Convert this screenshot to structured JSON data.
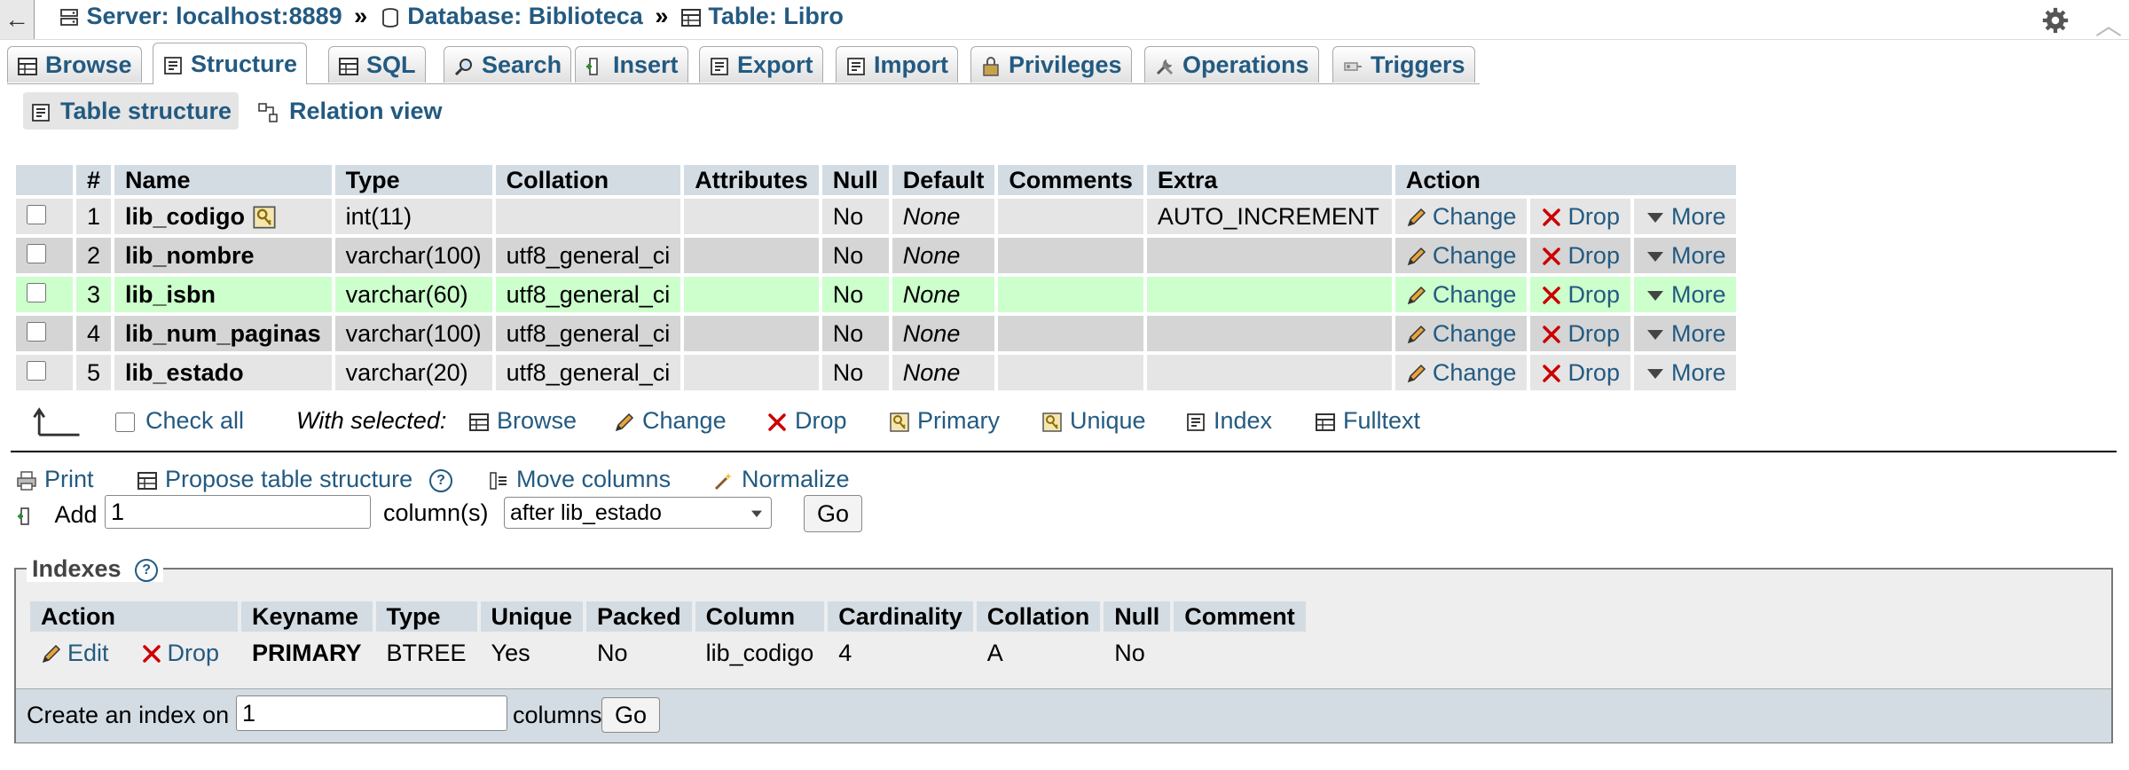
{
  "nav": {
    "back_glyph": "←",
    "breadcrumb": [
      {
        "label": "Server: localhost:8889",
        "icon": "server-icon"
      },
      {
        "label": "Database: Biblioteca",
        "icon": "database-icon"
      },
      {
        "label": "Table: Libro",
        "icon": "table-icon"
      }
    ],
    "separator": "»"
  },
  "tabs": [
    {
      "label": "Browse",
      "icon": "browse-icon"
    },
    {
      "label": "Structure",
      "icon": "structure-icon",
      "active": true
    },
    {
      "label": "SQL",
      "icon": "sql-icon"
    },
    {
      "label": "Search",
      "icon": "search-icon"
    },
    {
      "label": "Insert",
      "icon": "insert-icon"
    },
    {
      "label": "Export",
      "icon": "export-icon"
    },
    {
      "label": "Import",
      "icon": "import-icon"
    },
    {
      "label": "Privileges",
      "icon": "privileges-icon"
    },
    {
      "label": "Operations",
      "icon": "operations-icon"
    },
    {
      "label": "Triggers",
      "icon": "triggers-icon"
    }
  ],
  "subtabs": {
    "structure": "Table structure",
    "relation": "Relation view"
  },
  "structure_table": {
    "headers": [
      "#",
      "Name",
      "Type",
      "Collation",
      "Attributes",
      "Null",
      "Default",
      "Comments",
      "Extra",
      "Action"
    ],
    "rows": [
      {
        "num": "1",
        "name": "lib_codigo",
        "type": "int(11)",
        "collation": "",
        "attributes": "",
        "null": "No",
        "default": "None",
        "comments": "",
        "extra": "AUTO_INCREMENT",
        "primary_key": true
      },
      {
        "num": "2",
        "name": "lib_nombre",
        "type": "varchar(100)",
        "collation": "utf8_general_ci",
        "attributes": "",
        "null": "No",
        "default": "None",
        "comments": "",
        "extra": ""
      },
      {
        "num": "3",
        "name": "lib_isbn",
        "type": "varchar(60)",
        "collation": "utf8_general_ci",
        "attributes": "",
        "null": "No",
        "default": "None",
        "comments": "",
        "extra": "",
        "highlighted": true
      },
      {
        "num": "4",
        "name": "lib_num_paginas",
        "type": "varchar(100)",
        "collation": "utf8_general_ci",
        "attributes": "",
        "null": "No",
        "default": "None",
        "comments": "",
        "extra": ""
      },
      {
        "num": "5",
        "name": "lib_estado",
        "type": "varchar(20)",
        "collation": "utf8_general_ci",
        "attributes": "",
        "null": "No",
        "default": "None",
        "comments": "",
        "extra": ""
      }
    ],
    "actions": {
      "change": "Change",
      "drop": "Drop",
      "more": "More"
    }
  },
  "with_selected": {
    "check_all": "Check all",
    "label": "With selected:",
    "browse": "Browse",
    "change": "Change",
    "drop": "Drop",
    "primary": "Primary",
    "unique": "Unique",
    "index": "Index",
    "fulltext": "Fulltext"
  },
  "options": {
    "print": "Print",
    "propose": "Propose table structure",
    "move_columns": "Move columns",
    "normalize": "Normalize"
  },
  "add_column": {
    "label": "Add",
    "value": "1",
    "suffix": "column(s)",
    "position": "after lib_estado",
    "go": "Go"
  },
  "indexes": {
    "legend": "Indexes",
    "headers": [
      "Action",
      "Keyname",
      "Type",
      "Unique",
      "Packed",
      "Column",
      "Cardinality",
      "Collation",
      "Null",
      "Comment"
    ],
    "row": {
      "edit": "Edit",
      "drop": "Drop",
      "keyname": "PRIMARY",
      "type": "BTREE",
      "unique": "Yes",
      "packed": "No",
      "column": "lib_codigo",
      "cardinality": "4",
      "collation": "A",
      "null": "No",
      "comment": ""
    },
    "create": {
      "label": "Create an index on",
      "value": "1",
      "suffix": "columns",
      "go": "Go"
    }
  },
  "colors": {
    "link": "#235a81",
    "header_bg": "#d3dce3",
    "row_light": "#e5e5e5",
    "row_dark": "#d5d5d5",
    "row_highlight": "#ccffcc",
    "drop_red": "#cc0000"
  }
}
